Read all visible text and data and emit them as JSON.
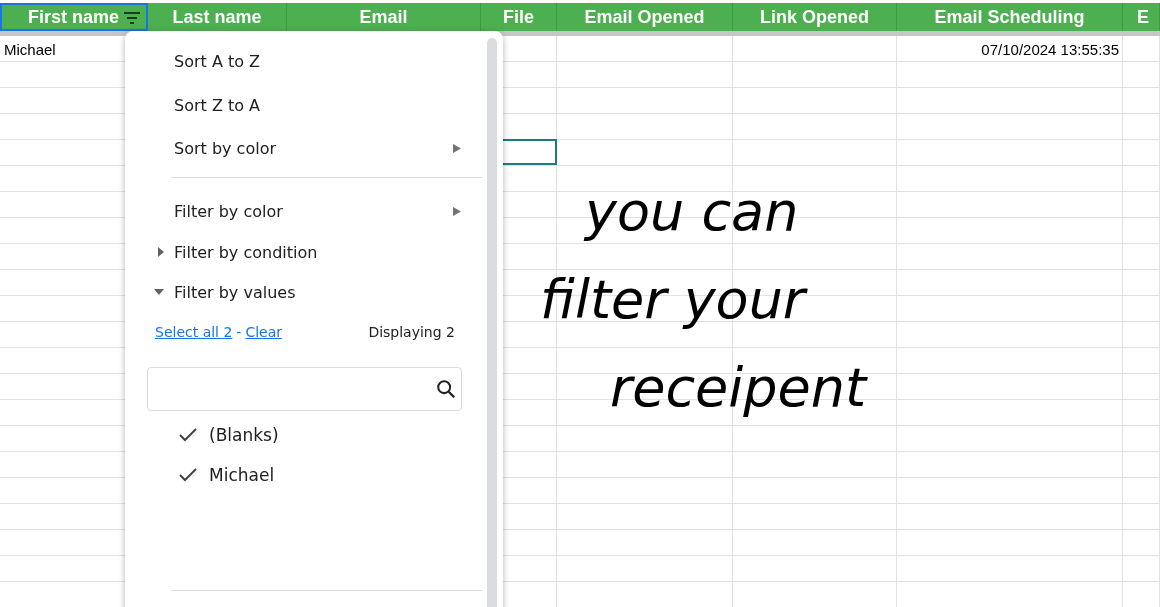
{
  "sheet": {
    "columns": [
      {
        "label": "First name",
        "selected": true,
        "filter": true
      },
      {
        "label": "Last name",
        "selected": false,
        "filter": false
      },
      {
        "label": "Email",
        "selected": false,
        "filter": false
      },
      {
        "label": "File",
        "selected": false,
        "filter": false
      },
      {
        "label": "Email Opened",
        "selected": false,
        "filter": false
      },
      {
        "label": "Link Opened",
        "selected": false,
        "filter": false
      },
      {
        "label": "Email Scheduling",
        "selected": false,
        "filter": false
      },
      {
        "label": "E",
        "selected": false,
        "filter": false
      }
    ],
    "rows": [
      {
        "first_name": "Michael",
        "email_scheduling": "07/10/2024 13:55:35",
        "active": false
      },
      {
        "active": false
      },
      {
        "active": false
      },
      {
        "active": false
      },
      {
        "active": true
      }
    ]
  },
  "filter_menu": {
    "items": [
      {
        "label": "Sort A to Z",
        "kind": "plain"
      },
      {
        "label": "Sort Z to A",
        "kind": "plain"
      },
      {
        "label": "Sort by color",
        "kind": "submenu"
      },
      {
        "kind": "divider"
      },
      {
        "label": "Filter by color",
        "kind": "submenu"
      },
      {
        "label": "Filter by condition",
        "kind": "collapsed"
      },
      {
        "label": "Filter by values",
        "kind": "expanded"
      }
    ],
    "select_all": "Select all 2",
    "separator": "-",
    "clear": "Clear",
    "displaying": "Displaying 2",
    "values": [
      {
        "label": "(Blanks)",
        "checked": true
      },
      {
        "label": "Michael",
        "checked": true
      }
    ]
  },
  "annotation": {
    "lines": [
      "you can",
      "filter your",
      "receipent"
    ]
  }
}
